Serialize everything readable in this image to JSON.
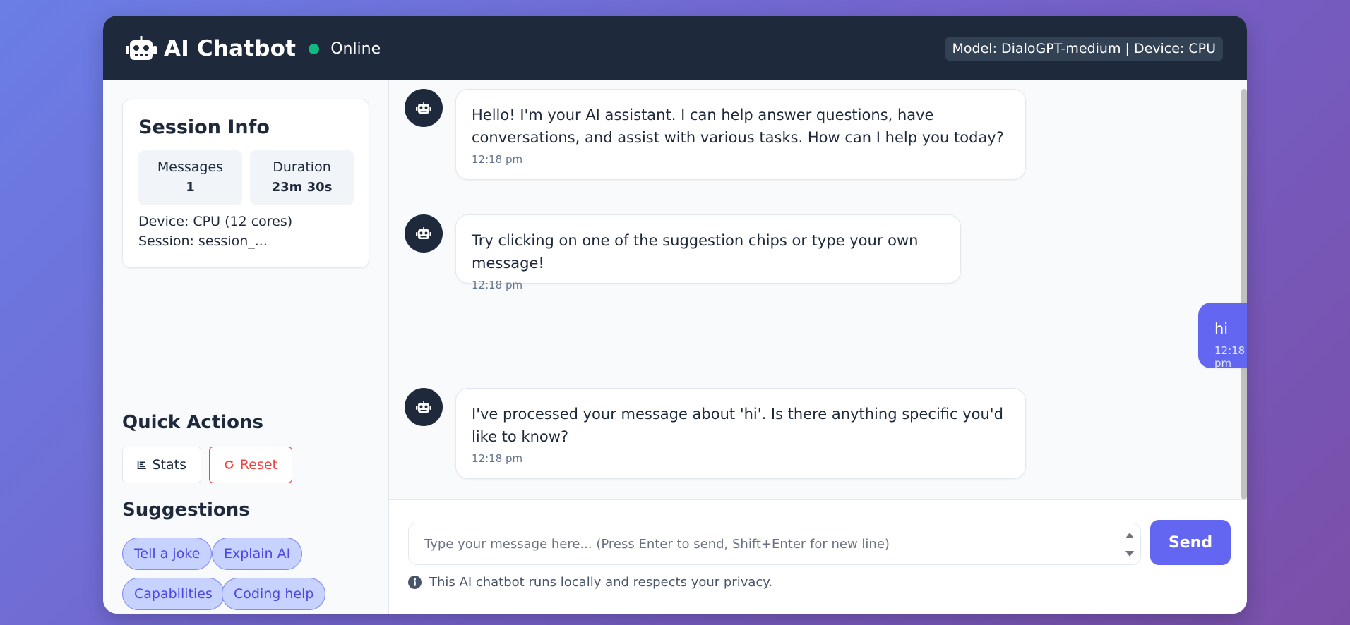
{
  "header": {
    "title": "AI Chatbot",
    "status": "Online",
    "model_info": "Model: DialoGPT-medium | Device: CPU",
    "status_color": "#10b981",
    "background": "#1e293b"
  },
  "sidebar": {
    "session": {
      "title": "Session Info",
      "messages_label": "Messages",
      "messages_value": "1",
      "duration_label": "Duration",
      "duration_value": "23m 30s",
      "device": "Device: CPU (12 cores)",
      "session_id": "Session: session_..."
    },
    "quick_actions": {
      "title": "Quick Actions",
      "stats_label": "Stats",
      "reset_label": "Reset"
    },
    "suggestions": {
      "title": "Suggestions",
      "chips": [
        "Tell a joke",
        "Explain AI",
        "Capabilities",
        "Coding help"
      ]
    }
  },
  "messages": [
    {
      "role": "bot",
      "text": "Hello! I'm your AI assistant. I can help answer questions, have conversations, and assist with various tasks. How can I help you today?",
      "time": "12:18 pm"
    },
    {
      "role": "bot",
      "text": "Try clicking on one of the suggestion chips or type your own message!",
      "time": "12:18 pm"
    },
    {
      "role": "user",
      "text": "hi",
      "time": "12:18 pm"
    },
    {
      "role": "bot",
      "text": "I've processed your message about 'hi'. Is there anything specific you'd like to know?",
      "time": "12:18 pm"
    }
  ],
  "input": {
    "placeholder": "Type your message here... (Press Enter to send, Shift+Enter for new line)",
    "value": "",
    "send_label": "Send",
    "privacy_note": "This AI chatbot runs locally and respects your privacy."
  },
  "colors": {
    "accent": "#6366f1",
    "reset_red": "#ef4444",
    "chip_bg": "#c7d2fe"
  }
}
